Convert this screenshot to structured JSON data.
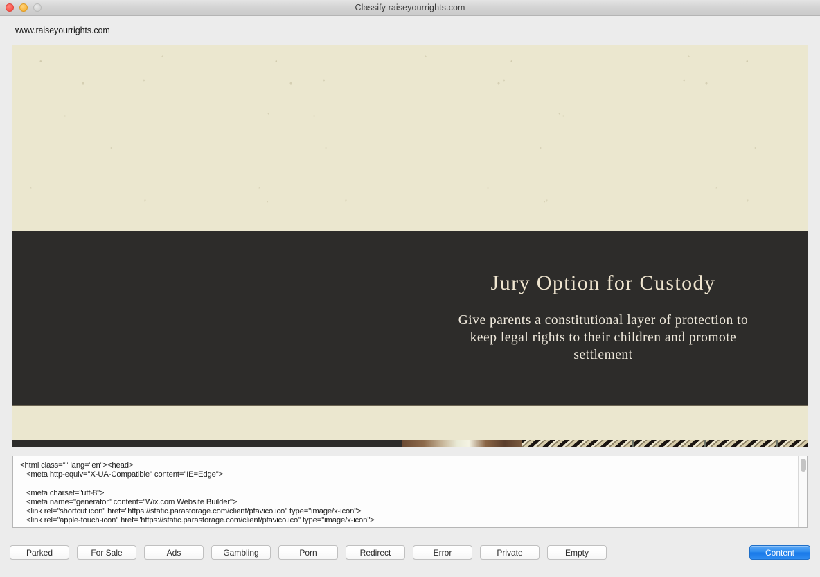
{
  "window": {
    "title": "Classify raiseyourrights.com",
    "traffic_lights": [
      {
        "name": "close",
        "color": "#f6463c"
      },
      {
        "name": "minimize",
        "color": "#f7ad27"
      },
      {
        "name": "zoom",
        "color": "#cbcccb"
      }
    ]
  },
  "url": {
    "value": "www.raiseyourrights.com"
  },
  "preview": {
    "hero": {
      "title": "Jury Option for Custody",
      "subtitle": "Give parents a constitutional layer of protection to\nkeep legal rights to their children and promote settlement",
      "background_color": "#2d2c2a",
      "page_background_color": "#ebe7cf",
      "title_color": "#efe5cf"
    }
  },
  "source": {
    "html": "<html class=\"\" lang=\"en\"><head>\n   <meta http-equiv=\"X-UA-Compatible\" content=\"IE=Edge\">\n\n   <meta charset=\"utf-8\">\n   <meta name=\"generator\" content=\"Wix.com Website Builder\">\n   <link rel=\"shortcut icon\" href=\"https://static.parastorage.com/client/pfavico.ico\" type=\"image/x-icon\">\n   <link rel=\"apple-touch-icon\" href=\"https://static.parastorage.com/client/pfavico.ico\" type=\"image/x-icon\">"
  },
  "toolbar": {
    "buttons": [
      {
        "label": "Parked"
      },
      {
        "label": "For Sale"
      },
      {
        "label": "Ads"
      },
      {
        "label": "Gambling"
      },
      {
        "label": "Porn"
      },
      {
        "label": "Redirect"
      },
      {
        "label": "Error"
      },
      {
        "label": "Private"
      },
      {
        "label": "Empty"
      }
    ],
    "primary_button": {
      "label": "Content",
      "color": "#2d8cf0"
    }
  }
}
